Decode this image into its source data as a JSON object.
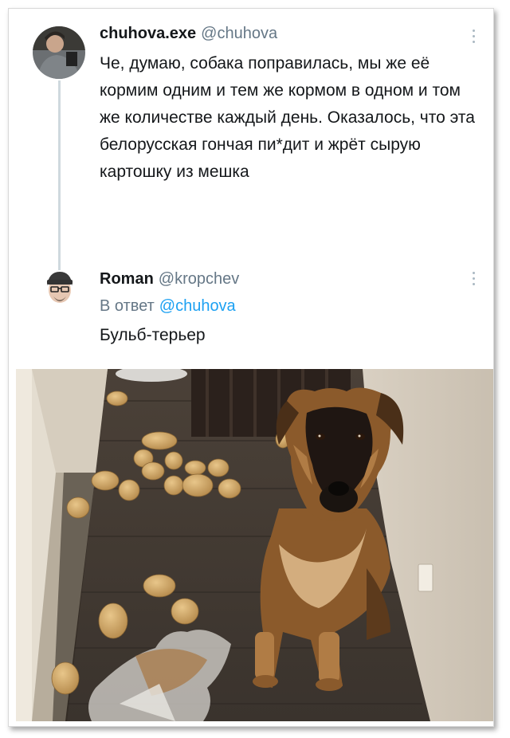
{
  "tweet": {
    "author_name": "chuhova.exe",
    "author_handle": "@chuhova",
    "text": "Че, думаю, собака поправилась, мы же её кормим одним и тем же кормом в одном и том же количестве каждый день. Оказалось, что эта белорусская гончая пи*дит и жрёт сырую картошку из мешка"
  },
  "reply": {
    "author_name": "Roman",
    "author_handle": "@kropchev",
    "reply_prefix": "В ответ",
    "reply_to": "@chuhova",
    "text": "Бульб-терьер"
  },
  "colors": {
    "handle": "#657786",
    "link": "#1da1f2",
    "thread_line": "#cfd9de"
  },
  "icons": [
    "more-icon",
    "avatar-chuhova",
    "avatar-roman"
  ]
}
